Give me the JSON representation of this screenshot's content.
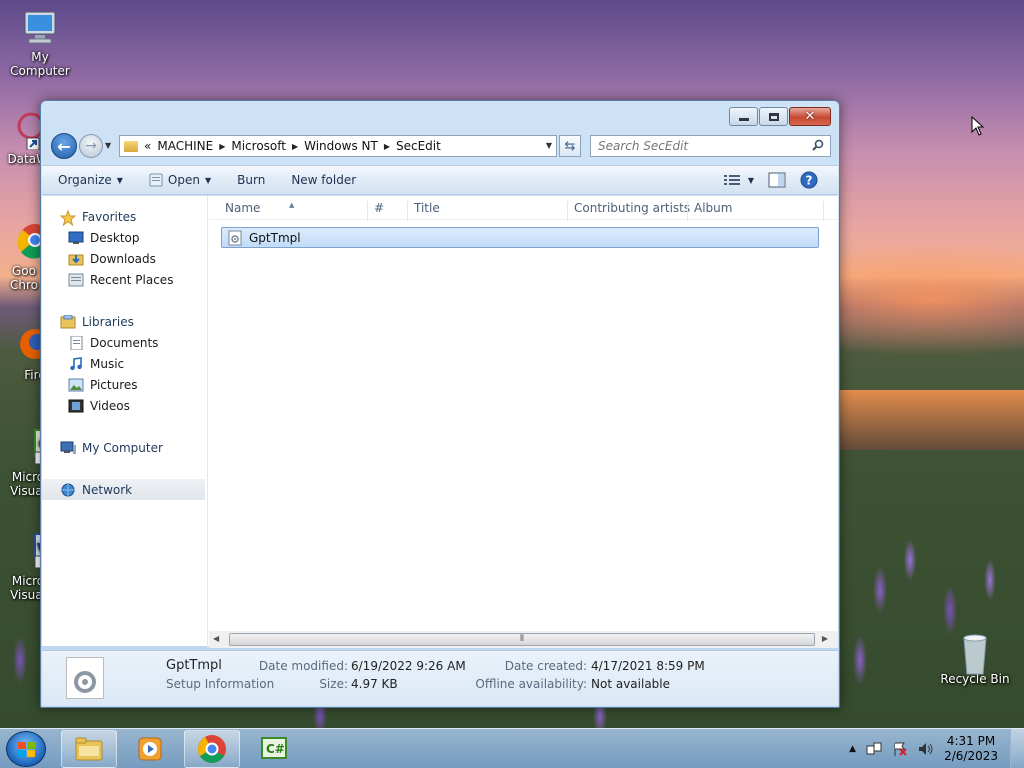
{
  "desktop": {
    "icons": [
      {
        "label": "My Computer"
      },
      {
        "label": "DataWa"
      },
      {
        "label": "Goo Chro"
      },
      {
        "label": "Fire"
      },
      {
        "label": "Micro Visual"
      },
      {
        "label": "Micro Visual"
      },
      {
        "label": "Recycle Bin"
      }
    ]
  },
  "window": {
    "address": {
      "overflow": "«",
      "crumbs": [
        "MACHINE",
        "Microsoft",
        "Windows NT",
        "SecEdit"
      ]
    },
    "search_placeholder": "Search SecEdit",
    "toolbar": {
      "organize": "Organize",
      "open": "Open",
      "burn": "Burn",
      "new_folder": "New folder"
    },
    "nav": {
      "favorites": "Favorites",
      "desktop": "Desktop",
      "downloads": "Downloads",
      "recent": "Recent Places",
      "libraries": "Libraries",
      "documents": "Documents",
      "music": "Music",
      "pictures": "Pictures",
      "videos": "Videos",
      "computer": "My Computer",
      "network": "Network"
    },
    "columns": [
      "Name",
      "#",
      "Title",
      "Contributing artists",
      "Album"
    ],
    "files": [
      {
        "name": "GptTmpl"
      }
    ],
    "details": {
      "name": "GptTmpl",
      "type": "Setup Information",
      "modified_label": "Date modified:",
      "modified_value": "6/19/2022 9:26 AM",
      "size_label": "Size:",
      "size_value": "4.97 KB",
      "created_label": "Date created:",
      "created_value": "4/17/2021 8:59 PM",
      "offline_label": "Offline availability:",
      "offline_value": "Not available"
    }
  },
  "taskbar": {
    "time": "4:31 PM",
    "date": "2/6/2023"
  }
}
